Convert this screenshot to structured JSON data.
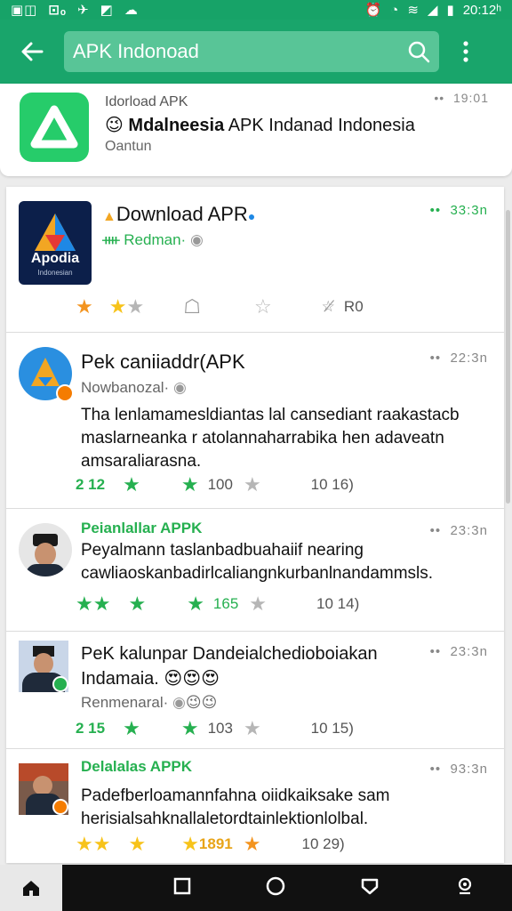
{
  "status": {
    "left_icons": [
      "sim-icon",
      "gallery-icon",
      "usb-icon",
      "file-icon",
      "cloud-icon"
    ],
    "time": "20:12ʰ"
  },
  "search": {
    "query": "APK Indonoad"
  },
  "top_card": {
    "label": "Idorload APK",
    "title_bold": "Mdalneesia",
    "title_rest": " APK Indanad Indonesia",
    "subtitle": "Oantun",
    "time": "19:01"
  },
  "posts": [
    {
      "title": "Download APR",
      "subtitle": "Redman·",
      "time": "33:3n",
      "logo_text": "Apodia",
      "logo_sub": "Indonesian",
      "count_right": "R0"
    },
    {
      "title": "Pek caniiaddr(APK",
      "subtitle": "Nowbanozal·",
      "time": "22:3n",
      "body": "Tha lenlamamesldiantas lal cansediant raakastacb maslarneanka r atolannaharrabika hen adaveatn amsaraliarasna.",
      "count_left": "2 12",
      "count_mid": "100",
      "count_right": "10  16)"
    },
    {
      "title": "Peianlallar APPK",
      "time": "23:3n",
      "body": "Peyalmann taslanbadbuahaiif nearing cawliaoskanbadirlcaliangnkurbanlnandammsls.",
      "count_mid": "165",
      "count_right": "10  14)"
    },
    {
      "title": "PeK kalunpar Dandeialchedioboiakan",
      "title2": "Indamaia.",
      "subtitle": "Renmenaral·",
      "time": "23:3n",
      "count_left": "2 15",
      "count_mid": "103",
      "count_right": "10  15)"
    },
    {
      "title": "Delalalas APPK",
      "time": "93:3n",
      "body": "Padefberloamannfahna oiidkaiksake sam herisialsahknallaletordtainlektionlolbal.",
      "count_mid": "1891",
      "count_right": "10  29)"
    }
  ],
  "colors": {
    "brand": "#19a56b",
    "star_green": "#26b050",
    "star_orange": "#f39420",
    "star_yellow": "#f7c31a"
  }
}
